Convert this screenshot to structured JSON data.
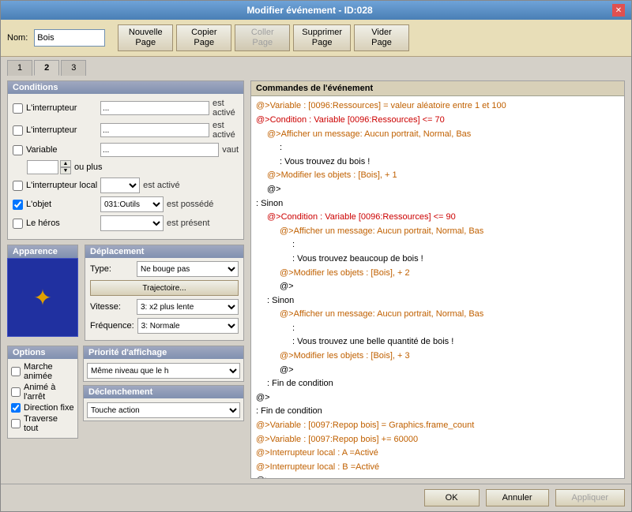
{
  "window": {
    "title": "Modifier événement - ID:028",
    "close_label": "✕"
  },
  "toolbar": {
    "name_label": "Nom:",
    "name_value": "Bois",
    "buttons": [
      {
        "label": "Nouvelle\nPage",
        "disabled": false
      },
      {
        "label": "Copier\nPage",
        "disabled": false
      },
      {
        "label": "Coller\nPage",
        "disabled": true
      },
      {
        "label": "Supprimer\nPage",
        "disabled": false
      },
      {
        "label": "Vider\nPage",
        "disabled": false
      }
    ]
  },
  "tabs": [
    {
      "label": "1",
      "active": false
    },
    {
      "label": "2",
      "active": true
    },
    {
      "label": "3",
      "active": false
    }
  ],
  "conditions": {
    "title": "Conditions",
    "rows": [
      {
        "checked": false,
        "label": "L'interrupteur",
        "suffix": "est activé"
      },
      {
        "checked": false,
        "label": "L'interrupteur",
        "suffix": "est activé"
      },
      {
        "checked": false,
        "label": "Variable",
        "suffix": "vaut"
      },
      {
        "checked": false,
        "label": "L'interrupteur local",
        "suffix": "est activé"
      },
      {
        "checked": true,
        "label": "L'objet",
        "value": "031:Outils",
        "suffix": "est possédé"
      },
      {
        "checked": false,
        "label": "Le héros",
        "suffix": "est présent"
      }
    ],
    "ou_plus": "ou plus"
  },
  "appearance": {
    "title": "Apparence"
  },
  "movement": {
    "title": "Déplacement",
    "type_label": "Type:",
    "type_value": "Ne bouge pas",
    "trajectory_btn": "Trajectoire...",
    "speed_label": "Vitesse:",
    "speed_value": "3: x2 plus lente",
    "freq_label": "Fréquence:",
    "freq_value": "3: Normale"
  },
  "options": {
    "title": "Options",
    "items": [
      {
        "label": "Marche animée",
        "checked": false
      },
      {
        "label": "Animé à l'arrêt",
        "checked": false
      },
      {
        "label": "Direction fixe",
        "checked": true
      },
      {
        "label": "Traverse tout",
        "checked": false
      }
    ]
  },
  "priority": {
    "title": "Priorité d'affichage",
    "value": "Même niveau que le h"
  },
  "trigger": {
    "title": "Déclenchement",
    "value": "Touche action"
  },
  "commands": {
    "title": "Commandes de l'événement",
    "lines": [
      {
        "indent": 0,
        "text": "@>Variable : [0096:Ressources] = valeur aléatoire entre 1 et 100",
        "color": "orange"
      },
      {
        "indent": 0,
        "text": "@>Condition : Variable [0096:Ressources] <= 70",
        "color": "red"
      },
      {
        "indent": 1,
        "text": "@>Afficher un message: Aucun portrait, Normal, Bas",
        "color": "orange"
      },
      {
        "indent": 2,
        "text": ":",
        "color": "black"
      },
      {
        "indent": 2,
        "text": ": Vous trouvez du bois !",
        "color": "black"
      },
      {
        "indent": 1,
        "text": "@>Modifier les objets : [Bois], + 1",
        "color": "orange"
      },
      {
        "indent": 1,
        "text": "@>",
        "color": "black"
      },
      {
        "indent": 0,
        "text": ": Sinon",
        "color": "black"
      },
      {
        "indent": 1,
        "text": "@>Condition : Variable [0096:Ressources] <= 90",
        "color": "red"
      },
      {
        "indent": 2,
        "text": "@>Afficher un message: Aucun portrait, Normal, Bas",
        "color": "orange"
      },
      {
        "indent": 3,
        "text": ":",
        "color": "black"
      },
      {
        "indent": 3,
        "text": ": Vous trouvez beaucoup de bois !",
        "color": "black"
      },
      {
        "indent": 2,
        "text": "@>Modifier les objets : [Bois], + 2",
        "color": "orange"
      },
      {
        "indent": 2,
        "text": "@>",
        "color": "black"
      },
      {
        "indent": 1,
        "text": ": Sinon",
        "color": "black"
      },
      {
        "indent": 2,
        "text": "@>Afficher un message: Aucun portrait, Normal, Bas",
        "color": "orange"
      },
      {
        "indent": 3,
        "text": ":",
        "color": "black"
      },
      {
        "indent": 3,
        "text": ": Vous trouvez une belle quantité de bois !",
        "color": "black"
      },
      {
        "indent": 2,
        "text": "@>Modifier les objets : [Bois], + 3",
        "color": "orange"
      },
      {
        "indent": 2,
        "text": "@>",
        "color": "black"
      },
      {
        "indent": 1,
        "text": ": Fin de condition",
        "color": "black"
      },
      {
        "indent": 0,
        "text": "@>",
        "color": "black"
      },
      {
        "indent": 0,
        "text": ": Fin de condition",
        "color": "black"
      },
      {
        "indent": 0,
        "text": "@>Variable : [0097:Repop bois] = Graphics.frame_count",
        "color": "orange"
      },
      {
        "indent": 0,
        "text": "@>Variable : [0097:Repop bois] += 60000",
        "color": "orange"
      },
      {
        "indent": 0,
        "text": "@>Interrupteur local : A =Activé",
        "color": "orange"
      },
      {
        "indent": 0,
        "text": "@>Interrupteur local : B =Activé",
        "color": "orange"
      },
      {
        "indent": 0,
        "text": "@>",
        "color": "black"
      }
    ]
  },
  "footer": {
    "ok": "OK",
    "cancel": "Annuler",
    "apply": "Appliquer"
  }
}
